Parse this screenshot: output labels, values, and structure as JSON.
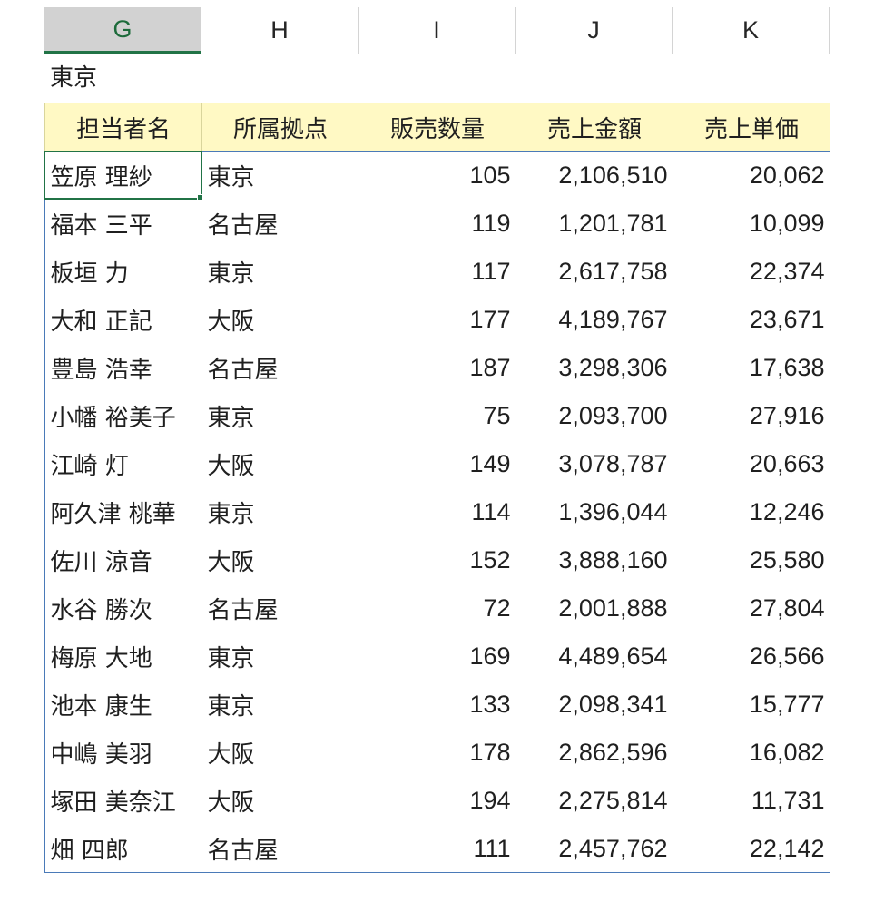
{
  "column_headers": [
    {
      "letter": "G",
      "selected": true
    },
    {
      "letter": "H",
      "selected": false
    },
    {
      "letter": "I",
      "selected": false
    },
    {
      "letter": "J",
      "selected": false
    },
    {
      "letter": "K",
      "selected": false
    }
  ],
  "title": "東京",
  "table": {
    "headers": [
      "担当者名",
      "所属拠点",
      "販売数量",
      "売上金額",
      "売上単価"
    ],
    "rows": [
      [
        "笠原 理紗",
        "東京",
        "105",
        "2,106,510",
        "20,062"
      ],
      [
        "福本 三平",
        "名古屋",
        "119",
        "1,201,781",
        "10,099"
      ],
      [
        "板垣 力",
        "東京",
        "117",
        "2,617,758",
        "22,374"
      ],
      [
        "大和 正記",
        "大阪",
        "177",
        "4,189,767",
        "23,671"
      ],
      [
        "豊島 浩幸",
        "名古屋",
        "187",
        "3,298,306",
        "17,638"
      ],
      [
        "小幡 裕美子",
        "東京",
        "75",
        "2,093,700",
        "27,916"
      ],
      [
        "江崎 灯",
        "大阪",
        "149",
        "3,078,787",
        "20,663"
      ],
      [
        "阿久津 桃華",
        "東京",
        "114",
        "1,396,044",
        "12,246"
      ],
      [
        "佐川 涼音",
        "大阪",
        "152",
        "3,888,160",
        "25,580"
      ],
      [
        "水谷 勝次",
        "名古屋",
        "72",
        "2,001,888",
        "27,804"
      ],
      [
        "梅原 大地",
        "東京",
        "169",
        "4,489,654",
        "26,566"
      ],
      [
        "池本 康生",
        "東京",
        "133",
        "2,098,341",
        "15,777"
      ],
      [
        "中嶋 美羽",
        "大阪",
        "178",
        "2,862,596",
        "16,082"
      ],
      [
        "塚田 美奈江",
        "大阪",
        "194",
        "2,275,814",
        "11,731"
      ],
      [
        "畑 四郎",
        "名古屋",
        "111",
        "2,457,762",
        "22,142"
      ]
    ]
  },
  "colors": {
    "header_fill": "#fff9c4",
    "table_border": "#4a7ab8",
    "selection": "#217346"
  }
}
